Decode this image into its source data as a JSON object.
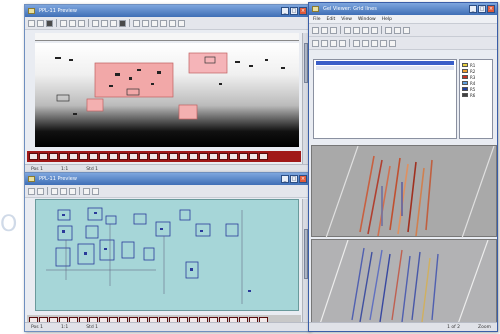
{
  "window1": {
    "title": "PPL-11 Preview",
    "menus": [],
    "status": [
      "Pos 1",
      "1:1",
      "Std 1"
    ]
  },
  "window2": {
    "title": "PPL-11 Preview",
    "status": [
      "Pos 1",
      "1:1",
      "Std 1"
    ]
  },
  "window3": {
    "title": "Gel Viewer: Grid lines",
    "menus": [
      "File",
      "Edit",
      "View",
      "Window",
      "Help"
    ],
    "legend": [
      {
        "label": "R1",
        "color": "#e8d040"
      },
      {
        "label": "R2",
        "color": "#f0a030"
      },
      {
        "label": "R3",
        "color": "#c83020"
      },
      {
        "label": "R4",
        "color": "#60a0e0"
      },
      {
        "label": "R5",
        "color": "#2040a0"
      },
      {
        "label": "R6",
        "color": "#404040"
      }
    ],
    "status": [
      "1 of 2",
      "Zoom"
    ]
  },
  "watermark": "O"
}
